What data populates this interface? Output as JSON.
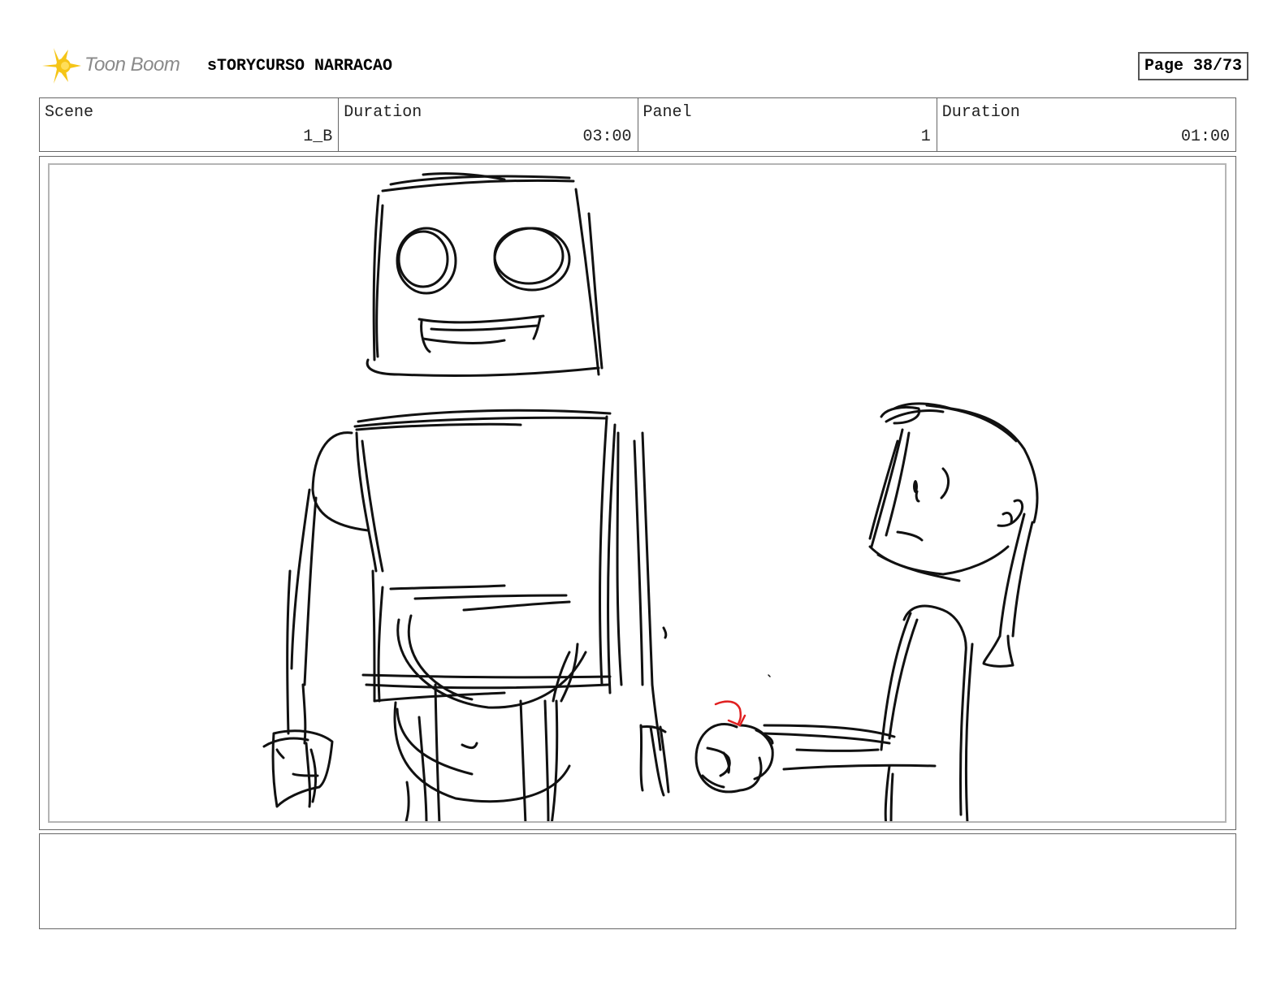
{
  "header": {
    "logo_text": "Toon Boom",
    "project_title": "sTORYCURSO NARRACAO",
    "page_label": "Page 38/73"
  },
  "info": {
    "scene_label": "Scene",
    "scene_value": "1_B",
    "scene_duration_label": "Duration",
    "scene_duration_value": "03:00",
    "panel_label": "Panel",
    "panel_value": "1",
    "panel_duration_label": "Duration",
    "panel_duration_value": "01:00"
  },
  "colors": {
    "logo_yellow": "#f5c518",
    "sketch_ink": "#111111",
    "annotation_red": "#e02020"
  },
  "notes": {
    "text": ""
  }
}
